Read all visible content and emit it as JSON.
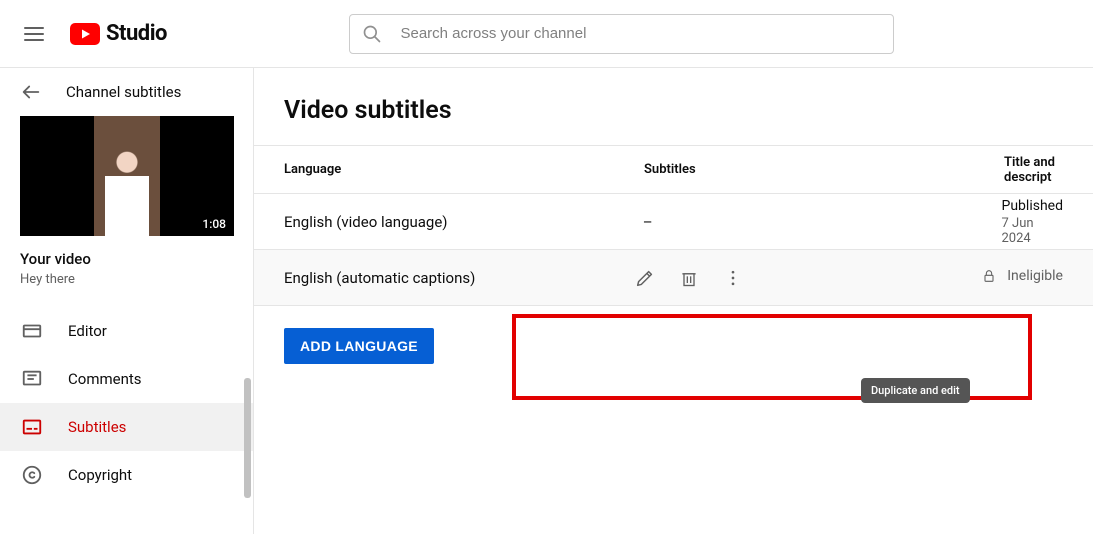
{
  "header": {
    "logo_text": "Studio",
    "search_placeholder": "Search across your channel"
  },
  "sidebar": {
    "back_label": "Channel subtitles",
    "thumbnail_duration": "1:08",
    "your_video_label": "Your video",
    "video_title": "Hey there",
    "nav": [
      {
        "id": "editor",
        "label": "Editor"
      },
      {
        "id": "comments",
        "label": "Comments"
      },
      {
        "id": "subtitles",
        "label": "Subtitles",
        "active": true
      },
      {
        "id": "copyright",
        "label": "Copyright"
      }
    ]
  },
  "main": {
    "page_title": "Video subtitles",
    "columns": {
      "language": "Language",
      "subtitles": "Subtitles",
      "title_desc": "Title and descript"
    },
    "rows": [
      {
        "language": "English (video language)",
        "subtitle_cell": "–",
        "status": "Published",
        "status_sub": "7 Jun 2024"
      },
      {
        "language": "English (automatic captions)",
        "has_actions": true,
        "status_locked": "Ineligible"
      }
    ],
    "tooltip": "Duplicate and edit",
    "add_language_label": "ADD LANGUAGE"
  }
}
